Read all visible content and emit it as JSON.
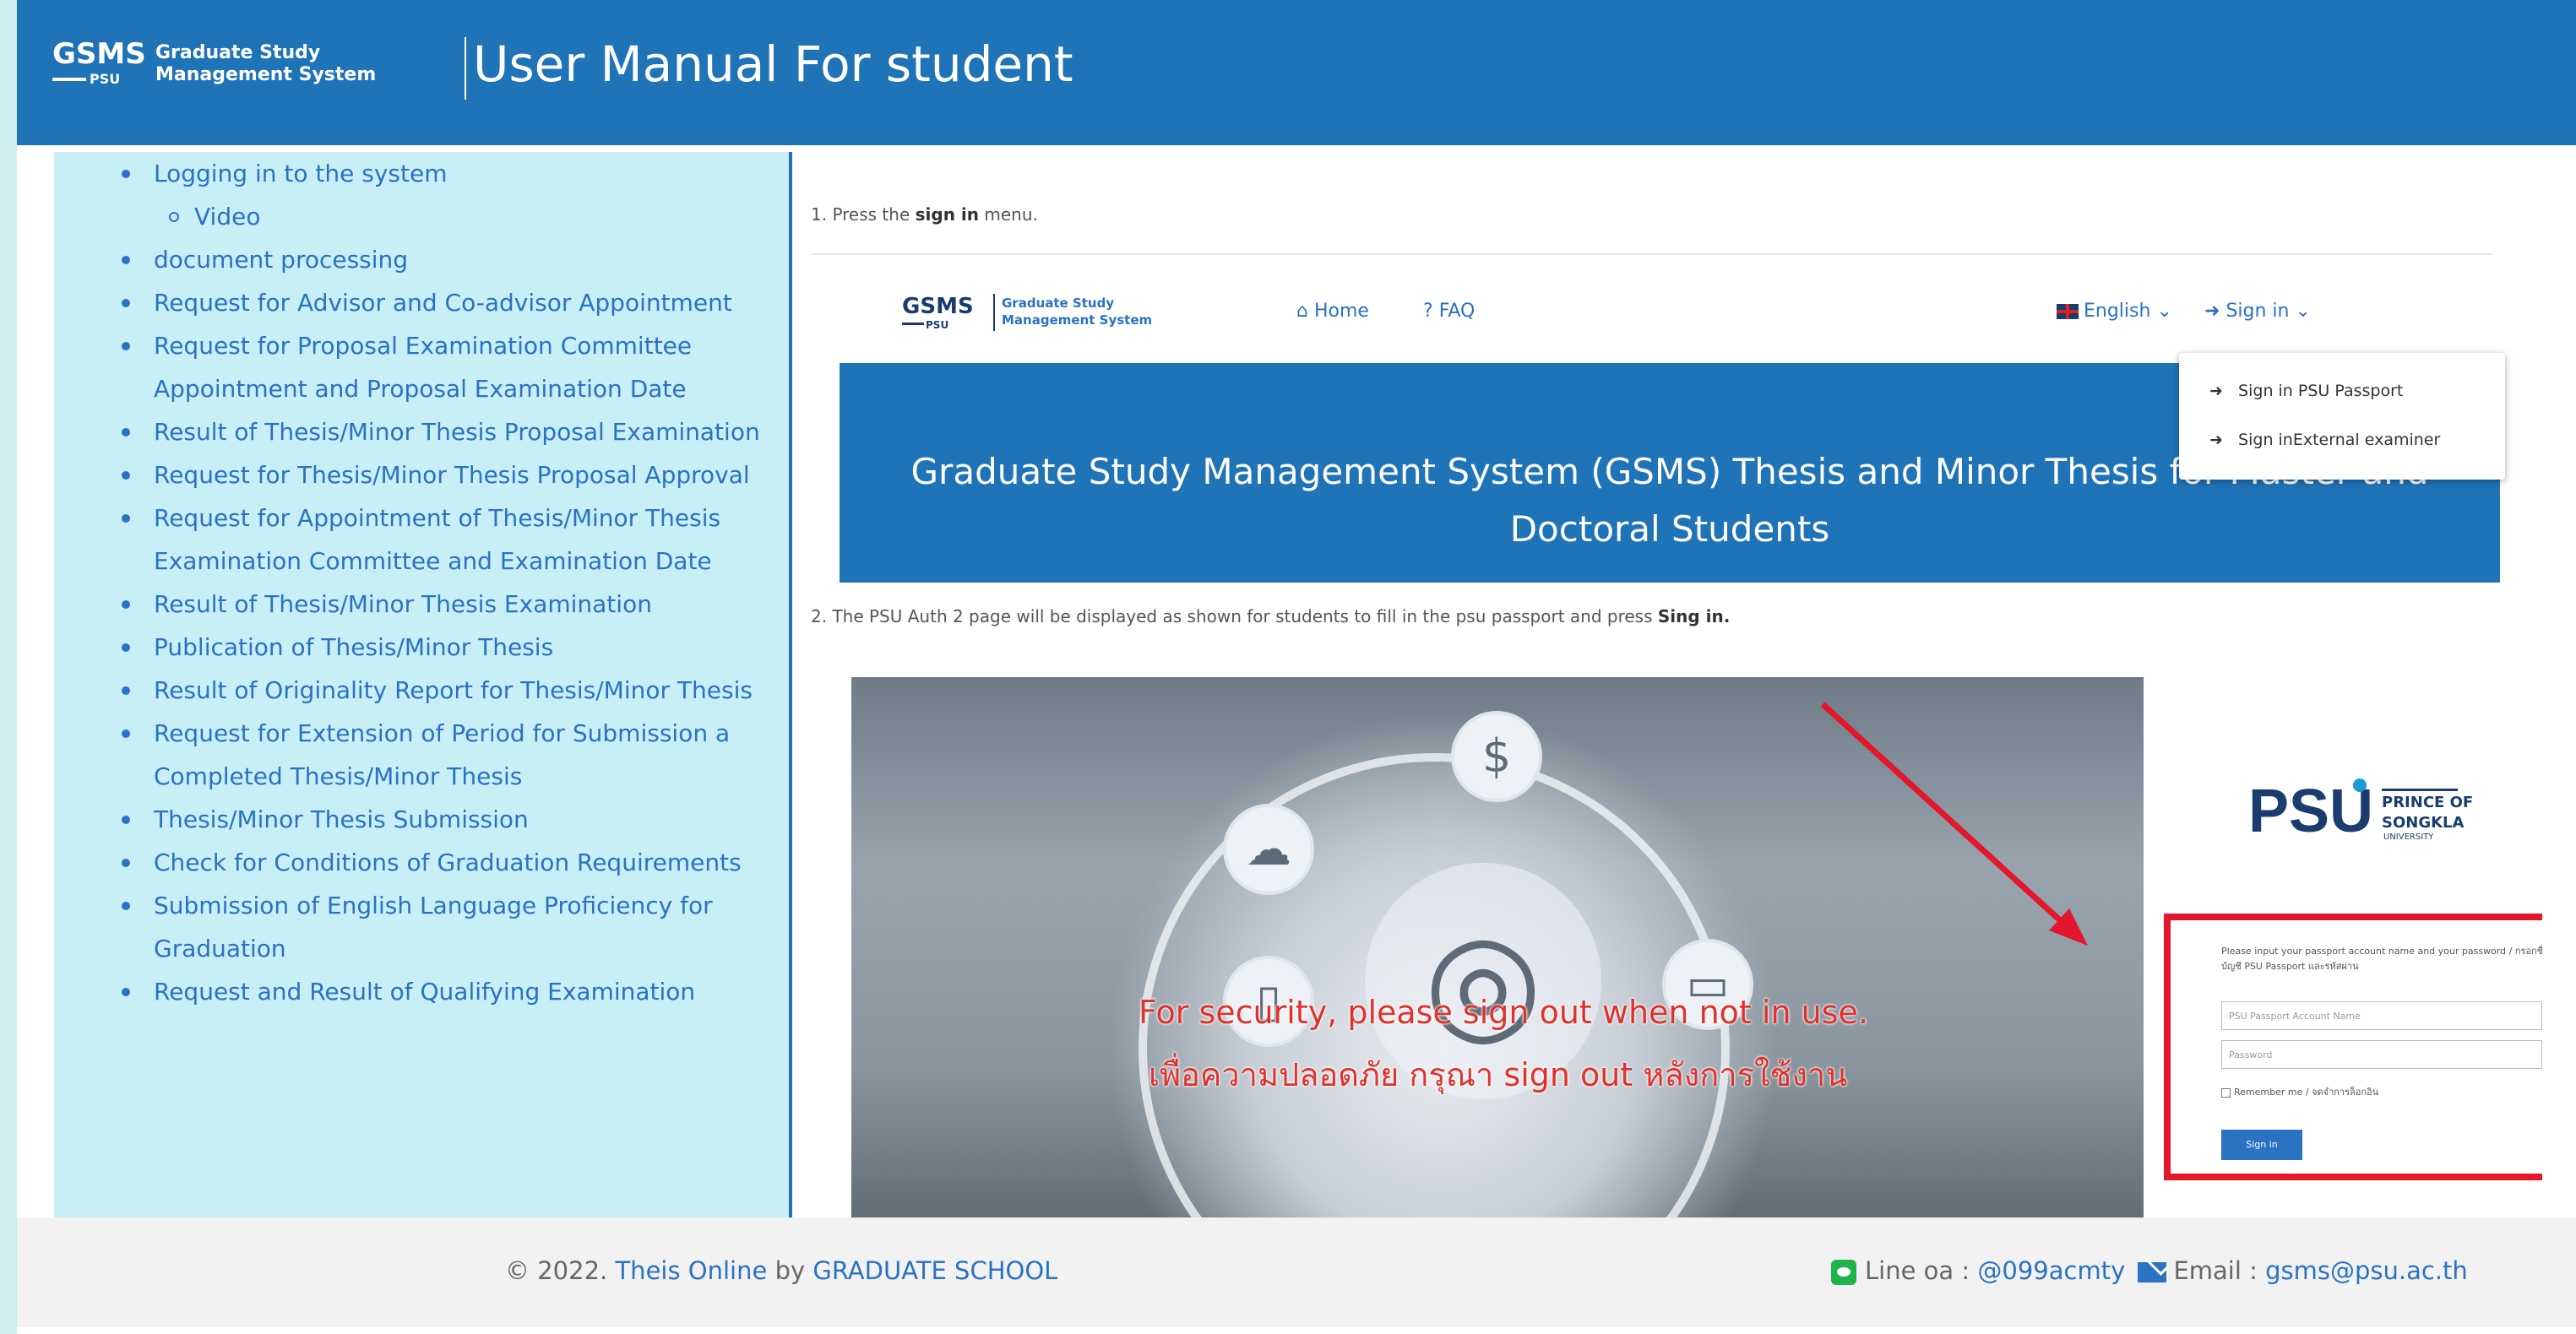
{
  "header": {
    "logo_gsms": "GSMS",
    "logo_psu": "PSU",
    "logo_line1": "Graduate Study",
    "logo_line2": "Management System",
    "title": "User Manual For student"
  },
  "sidebar": {
    "items": [
      {
        "label": "Logging in to the system",
        "sub": [
          "Video"
        ]
      },
      {
        "label": "document processing"
      },
      {
        "label": "Request for Advisor and Co-advisor Appointment"
      },
      {
        "label": "Request for Proposal Examination Committee Appointment and Proposal Examination Date"
      },
      {
        "label": "Result of Thesis/Minor Thesis Proposal Examination"
      },
      {
        "label": "Request for Thesis/Minor Thesis Proposal Approval"
      },
      {
        "label": "Request for Appointment of Thesis/Minor Thesis Examination Committee and Examination Date"
      },
      {
        "label": "Result of Thesis/Minor Thesis Examination"
      },
      {
        "label": "Publication of Thesis/Minor Thesis"
      },
      {
        "label": "Result of Originality Report for Thesis/Minor Thesis"
      },
      {
        "label": "Request for Extension of Period for Submission a Completed Thesis/Minor Thesis"
      },
      {
        "label": "Thesis/Minor Thesis Submission"
      },
      {
        "label": "Check for Conditions of Graduation Requirements"
      },
      {
        "label": "Submission of English Language Proficiency for Graduation"
      },
      {
        "label": "Request and Result of Qualifying Examination"
      }
    ]
  },
  "main": {
    "step1_prefix": "1. Press the",
    "step1_bold": "sign in",
    "step1_suffix": "menu.",
    "step2_prefix": "2. The PSU Auth 2 page will be displayed as shown for students to fill in the psu passport and press",
    "step2_bold": "Sing in.",
    "shot1": {
      "logo_gsms": "GSMS",
      "logo_psu": "PSU",
      "logo_line1": "Graduate Study",
      "logo_line2": "Management System",
      "home": "Home",
      "faq": "FAQ",
      "english": "English",
      "signin": "Sign in",
      "dropdown": [
        "Sign in PSU Passport",
        "Sign inExternal examiner"
      ],
      "banner_line1": "Graduate Study Management System (GSMS) Thesis and Minor Thesis for Master and",
      "banner_line2": "Doctoral Students"
    },
    "shot2": {
      "warning_en": "For security, please sign out when not in use.",
      "warning_th": "เพื่อความปลอดภัย กรุณา sign out หลังการใช้งาน",
      "psu_mark": "PSU",
      "psu_name1": "PRINCE OF",
      "psu_name2": "SONGKLA",
      "psu_name3": "UNIVERSITY",
      "login_hint": "Please input your passport account name and your password / กรอกชื่อบัญชี PSU Passport และรหัสผ่าน",
      "username_placeholder": "PSU Passport Account Name",
      "password_placeholder": "Password",
      "remember": "Remember me / จดจำการล็อกอิน",
      "signin_button": "Sign in"
    }
  },
  "footer": {
    "copyright_prefix": "© 2022.",
    "site_name": "Theis Online",
    "by": "by",
    "org": "GRADUATE SCHOOL",
    "line_label": "Line oa :",
    "line_id": "@099acmty",
    "email_label": "Email :",
    "email": "gsms@psu.ac.th"
  },
  "colors": {
    "header_bg": "#1f73b7",
    "sidebar_bg": "#c8eef6",
    "link": "#2a72c2",
    "warning": "#e0322d",
    "highlight_box": "#e3162b"
  }
}
